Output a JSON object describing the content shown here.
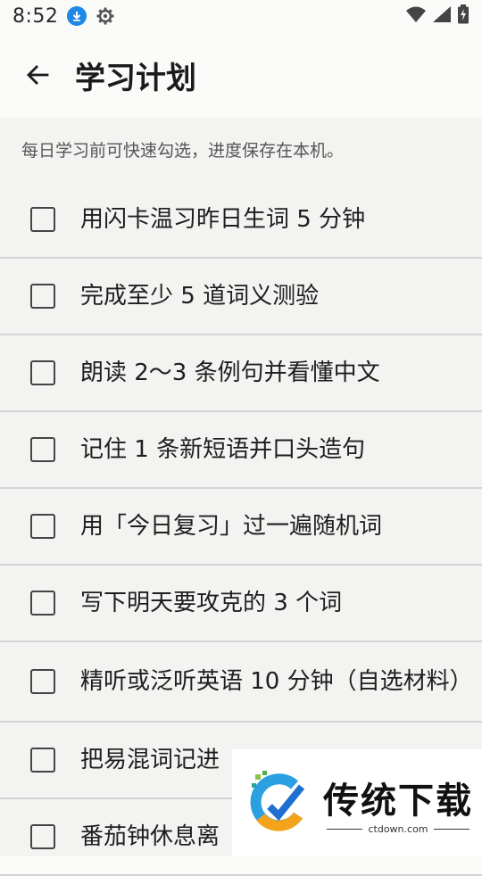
{
  "status_bar": {
    "time": "8:52",
    "icons": [
      "download-icon",
      "gear-icon",
      "wifi-icon",
      "signal-icon",
      "battery-charging-icon"
    ]
  },
  "app_bar": {
    "back_icon": "arrow-left-icon",
    "title": "学习计划"
  },
  "hint": "每日学习前可快速勾选，进度保存在本机。",
  "tasks": [
    {
      "label": "用闪卡温习昨日生词 5 分钟",
      "checked": false
    },
    {
      "label": "完成至少 5 道词义测验",
      "checked": false
    },
    {
      "label": "朗读 2～3 条例句并看懂中文",
      "checked": false
    },
    {
      "label": "记住 1 条新短语并口头造句",
      "checked": false
    },
    {
      "label": "用「今日复习」过一遍随机词",
      "checked": false
    },
    {
      "label": "写下明天要攻克的 3 个词",
      "checked": false
    },
    {
      "label": "精听或泛听英语 10 分钟（自选材料）",
      "checked": false
    },
    {
      "label": "把易混词记进",
      "checked": false
    },
    {
      "label": "番茄钟休息离",
      "checked": false
    }
  ],
  "watermark": {
    "brand": "传统下载",
    "url": "ctdown.com"
  },
  "colors": {
    "accent_blue": "#1e88e5",
    "background": "#f3f3f1"
  }
}
